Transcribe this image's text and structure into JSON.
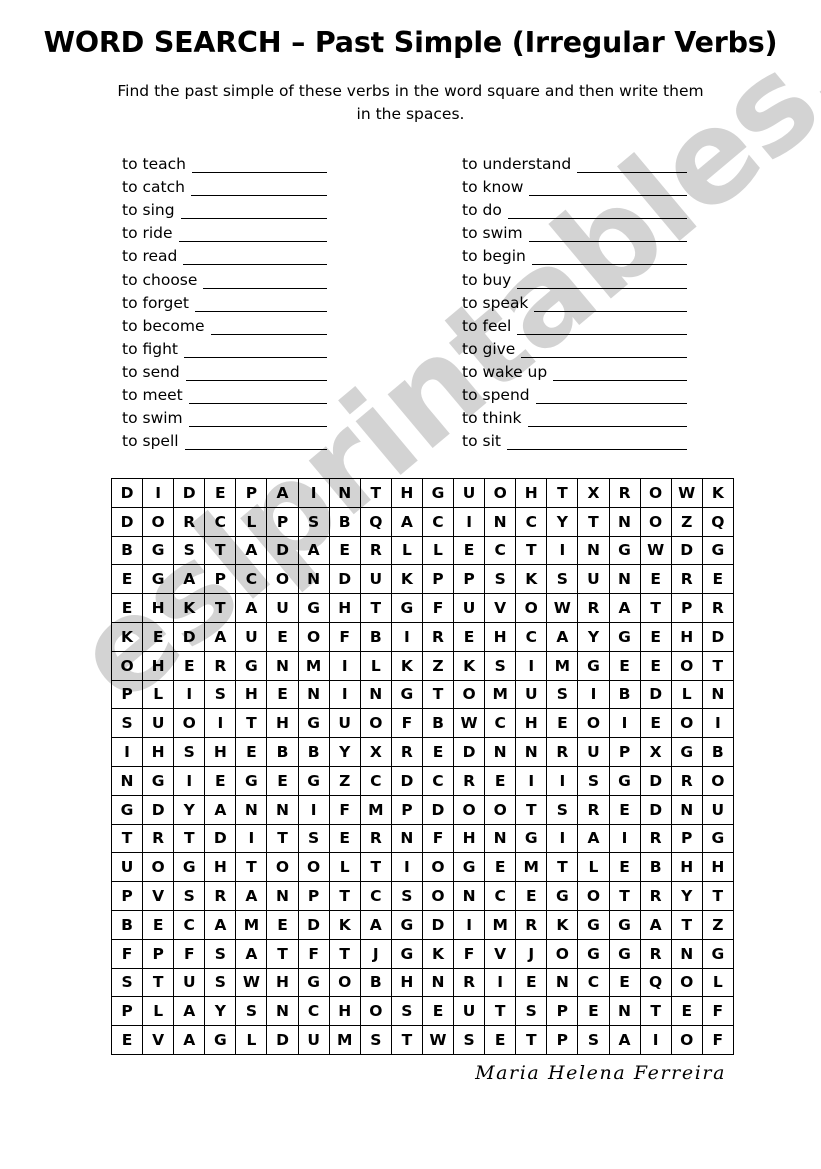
{
  "page": {
    "title": "WORD SEARCH – Past Simple (Irregular Verbs)",
    "instructions": "Find the past simple of these verbs in the word square and then write them in the spaces.",
    "signature": "Maria Helena Ferreira",
    "watermark": "eslprintables.com",
    "watermark_color": "#cccccc",
    "background_color": "#ffffff",
    "ink_color": "#000000"
  },
  "verbs": {
    "left_column": [
      "to teach",
      "to catch",
      "to sing",
      "to ride",
      "to read",
      "to choose",
      "to forget",
      "to become",
      "to fight",
      "to send",
      "to meet",
      "to swim",
      "to spell"
    ],
    "right_column": [
      "to understand",
      "to know",
      "to do",
      "to swim",
      "to begin",
      "to buy",
      "to speak",
      "to feel",
      "to give",
      "to wake up",
      "to spend",
      "to think",
      "to sit"
    ]
  },
  "grid": {
    "rows": 20,
    "cols": 20,
    "letters": [
      [
        "D",
        "I",
        "D",
        "E",
        "P",
        "A",
        "I",
        "N",
        "T",
        "H",
        "G",
        "U",
        "O",
        "H",
        "T",
        "X",
        "R",
        "O",
        "W",
        "K"
      ],
      [
        "D",
        "O",
        "R",
        "C",
        "L",
        "P",
        "S",
        "B",
        "Q",
        "A",
        "C",
        "I",
        "N",
        "C",
        "Y",
        "T",
        "N",
        "O",
        "Z",
        "Q"
      ],
      [
        "B",
        "G",
        "S",
        "T",
        "A",
        "D",
        "A",
        "E",
        "R",
        "L",
        "L",
        "E",
        "C",
        "T",
        "I",
        "N",
        "G",
        "W",
        "D",
        "G"
      ],
      [
        "E",
        "G",
        "A",
        "P",
        "C",
        "O",
        "N",
        "D",
        "U",
        "K",
        "P",
        "P",
        "S",
        "K",
        "S",
        "U",
        "N",
        "E",
        "R",
        "E"
      ],
      [
        "E",
        "H",
        "K",
        "T",
        "A",
        "U",
        "G",
        "H",
        "T",
        "G",
        "F",
        "U",
        "V",
        "O",
        "W",
        "R",
        "A",
        "T",
        "P",
        "R"
      ],
      [
        "K",
        "E",
        "D",
        "A",
        "U",
        "E",
        "O",
        "F",
        "B",
        "I",
        "R",
        "E",
        "H",
        "C",
        "A",
        "Y",
        "G",
        "E",
        "H",
        "D"
      ],
      [
        "O",
        "H",
        "E",
        "R",
        "G",
        "N",
        "M",
        "I",
        "L",
        "K",
        "Z",
        "K",
        "S",
        "I",
        "M",
        "G",
        "E",
        "E",
        "O",
        "T"
      ],
      [
        "P",
        "L",
        "I",
        "S",
        "H",
        "E",
        "N",
        "I",
        "N",
        "G",
        "T",
        "O",
        "M",
        "U",
        "S",
        "I",
        "B",
        "D",
        "L",
        "N"
      ],
      [
        "S",
        "U",
        "O",
        "I",
        "T",
        "H",
        "G",
        "U",
        "O",
        "F",
        "B",
        "W",
        "C",
        "H",
        "E",
        "O",
        "I",
        "E",
        "O",
        "I"
      ],
      [
        "I",
        "H",
        "S",
        "H",
        "E",
        "B",
        "B",
        "Y",
        "X",
        "R",
        "E",
        "D",
        "N",
        "N",
        "R",
        "U",
        "P",
        "X",
        "G",
        "B"
      ],
      [
        "N",
        "G",
        "I",
        "E",
        "G",
        "E",
        "G",
        "Z",
        "C",
        "D",
        "C",
        "R",
        "E",
        "I",
        "I",
        "S",
        "G",
        "D",
        "R",
        "O"
      ],
      [
        "G",
        "D",
        "Y",
        "A",
        "N",
        "N",
        "I",
        "F",
        "M",
        "P",
        "D",
        "O",
        "O",
        "T",
        "S",
        "R",
        "E",
        "D",
        "N",
        "U"
      ],
      [
        "T",
        "R",
        "T",
        "D",
        "I",
        "T",
        "S",
        "E",
        "R",
        "N",
        "F",
        "H",
        "N",
        "G",
        "I",
        "A",
        "I",
        "R",
        "P",
        "G"
      ],
      [
        "U",
        "O",
        "G",
        "H",
        "T",
        "O",
        "O",
        "L",
        "T",
        "I",
        "O",
        "G",
        "E",
        "M",
        "T",
        "L",
        "E",
        "B",
        "H",
        "H"
      ],
      [
        "P",
        "V",
        "S",
        "R",
        "A",
        "N",
        "P",
        "T",
        "C",
        "S",
        "O",
        "N",
        "C",
        "E",
        "G",
        "O",
        "T",
        "R",
        "Y",
        "T"
      ],
      [
        "B",
        "E",
        "C",
        "A",
        "M",
        "E",
        "D",
        "K",
        "A",
        "G",
        "D",
        "I",
        "M",
        "R",
        "K",
        "G",
        "G",
        "A",
        "T",
        "Z"
      ],
      [
        "F",
        "P",
        "F",
        "S",
        "A",
        "T",
        "F",
        "T",
        "J",
        "G",
        "K",
        "F",
        "V",
        "J",
        "O",
        "G",
        "G",
        "R",
        "N",
        "G"
      ],
      [
        "S",
        "T",
        "U",
        "S",
        "W",
        "H",
        "G",
        "O",
        "B",
        "H",
        "N",
        "R",
        "I",
        "E",
        "N",
        "C",
        "E",
        "Q",
        "O",
        "L"
      ],
      [
        "P",
        "L",
        "A",
        "Y",
        "S",
        "N",
        "C",
        "H",
        "O",
        "S",
        "E",
        "U",
        "T",
        "S",
        "P",
        "E",
        "N",
        "T",
        "E",
        "F"
      ],
      [
        "E",
        "V",
        "A",
        "G",
        "L",
        "D",
        "U",
        "M",
        "S",
        "T",
        "W",
        "S",
        "E",
        "T",
        "P",
        "S",
        "A",
        "I",
        "O",
        "F"
      ]
    ]
  }
}
